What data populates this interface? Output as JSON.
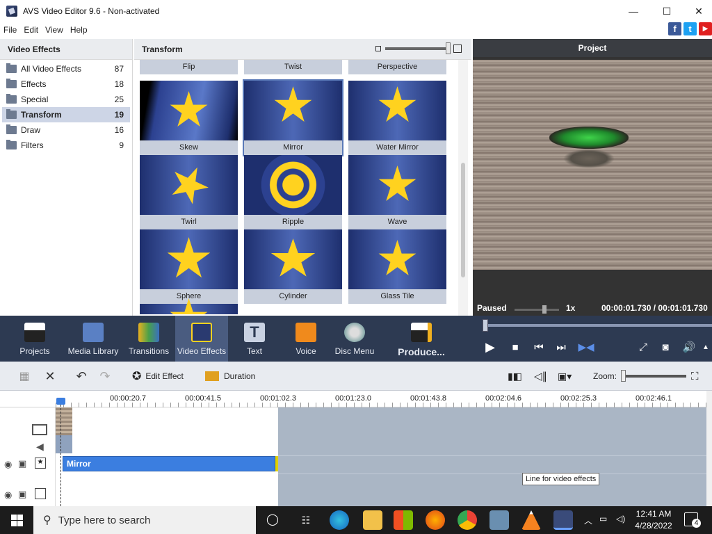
{
  "window": {
    "title": "AVS Video Editor 9.6 - Non-activated",
    "minimize": "—",
    "maximize": "☐",
    "close": "✕"
  },
  "menu": [
    "File",
    "Edit",
    "View",
    "Help"
  ],
  "social": {
    "facebook": "f",
    "twitter": "t",
    "youtube": "▶"
  },
  "left_panel": {
    "title": "Video Effects",
    "categories": [
      {
        "label": "All Video Effects",
        "count": "87"
      },
      {
        "label": "Effects",
        "count": "18"
      },
      {
        "label": "Special",
        "count": "25"
      },
      {
        "label": "Transform",
        "count": "19"
      },
      {
        "label": "Draw",
        "count": "16"
      },
      {
        "label": "Filters",
        "count": "9"
      }
    ],
    "selected": "Transform"
  },
  "center_panel": {
    "title": "Transform",
    "tiles": [
      "Flip",
      "Twist",
      "Perspective",
      "Skew",
      "Mirror",
      "Water Mirror",
      "Twirl",
      "Ripple",
      "Wave",
      "Sphere",
      "Cylinder",
      "Glass Tile"
    ],
    "selected": "Mirror"
  },
  "preview": {
    "title": "Project",
    "status": "Paused",
    "speed": "1x",
    "time": "00:00:01.730 / 00:01:01.730"
  },
  "toolbar": {
    "items": [
      "Projects",
      "Media Library",
      "Transitions",
      "Video Effects",
      "Text",
      "Voice",
      "Disc Menu"
    ],
    "produce": "Produce...",
    "active": "Video Effects"
  },
  "timeline_toolbar": {
    "edit_effect": "Edit Effect",
    "duration": "Duration",
    "zoom": "Zoom:"
  },
  "ruler": [
    "00:00:20.7",
    "00:00:41.5",
    "00:01:02.3",
    "00:01:23.0",
    "00:01:43.8",
    "00:02:04.6",
    "00:02:25.3",
    "00:02:46.1"
  ],
  "timeline": {
    "effect_clip": "Mirror",
    "tooltip": "Line for video effects"
  },
  "taskbar": {
    "search_placeholder": "Type here to search",
    "time": "12:41 AM",
    "date": "4/28/2022",
    "notifications": "4"
  },
  "colors": {
    "toolbar_bg": "#2d3a52",
    "accent": "#3b7ee0",
    "star": "#ffd21f"
  }
}
